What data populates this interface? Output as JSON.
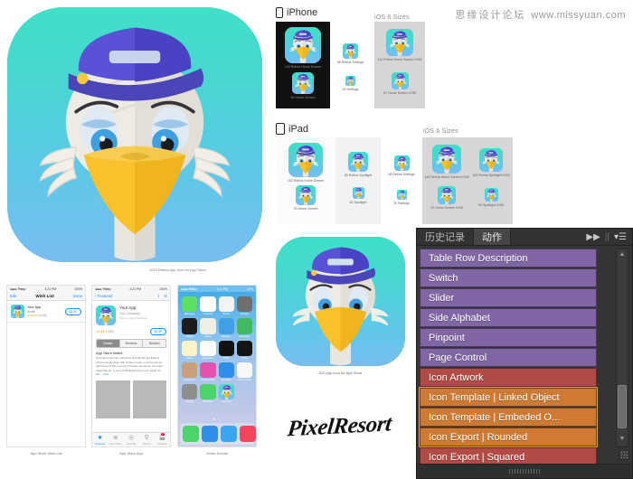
{
  "watermark": {
    "cn": "思缘设计论坛",
    "url": "www.missyuan.com"
  },
  "hero": {
    "name": "app-icon-artwork"
  },
  "iphone_section": {
    "label": "iPhone",
    "ios6_label": "iOS 6 Sizes",
    "dark_items": [
      {
        "cap": "120 Retina Home Screen",
        "size": 56
      },
      {
        "cap": "60 Home Screen",
        "size": 32
      }
    ],
    "light_items": [
      {
        "cap": "58 Retina Settings",
        "size": 24
      },
      {
        "cap": "29 Settings",
        "size": 15
      }
    ],
    "ios6_items": [
      {
        "cap": "114 Retina Home Screen iOS6",
        "size": 36
      },
      {
        "cap": "57 Home Screen iOS6",
        "size": 24
      }
    ]
  },
  "ipad_section": {
    "label": "iPad",
    "ios6_label": "iOS 6 Sizes",
    "col1": [
      {
        "cap": "152 Retina Home Screen",
        "size": 50
      },
      {
        "cap": "76 Home Screen",
        "size": 27
      }
    ],
    "col2": [
      {
        "cap": "80 Retina Spotlight",
        "size": 27
      },
      {
        "cap": "40 Spotlight",
        "size": 16
      }
    ],
    "col3": [
      {
        "cap": "58 Retina Settings",
        "size": 20
      },
      {
        "cap": "29 Settings",
        "size": 13
      }
    ],
    "ios6_col1": [
      {
        "cap": "144 Retina Home Screen iOS6",
        "size": 40
      },
      {
        "cap": "72 Home Screen iOS6",
        "size": 24
      }
    ],
    "ios6_col2": [
      {
        "cap": "100 Retina Spotlight iOS6",
        "size": 30
      },
      {
        "cap": "50 Spotlight iOS6",
        "size": 18
      }
    ]
  },
  "big_icon": {
    "caption": "512 App Icon for App Store"
  },
  "top_caption": "1024 Retina App Icon for App Store",
  "logo": {
    "text": "PixelResort"
  },
  "shot_wishlist": {
    "caption": "App Store Wish List",
    "status": {
      "carrier": "●●●●○ Pixelup ᱸ",
      "time": "4:21 PM",
      "battery": "100%"
    },
    "nav": {
      "left": "Edit",
      "title": "Wish List",
      "right": "Done"
    },
    "row": {
      "name": "Your App",
      "sub": "Health",
      "stars": "★★★★★",
      "count": "(2,232)",
      "price": "$2.99"
    }
  },
  "shot_appstore": {
    "caption": "App Store App",
    "status": {
      "carrier": "●●●●○ Pixelup ᱸ",
      "time": "4:21 PM",
      "battery": "100%"
    },
    "nav": {
      "back": "‹ Featured",
      "share": "share-icon",
      "list": "list-icon"
    },
    "app": {
      "title": "Your App",
      "company": "Your Company ›",
      "iap": "Offers In-App Purchases",
      "stars": "★★★★★",
      "count": "(219)",
      "price": "$2.99"
    },
    "segments": [
      "Details",
      "Reviews",
      "Related"
    ],
    "notes_title": "App Store Notes",
    "notes_body": "Now this is the story all about how My life got flipped, turned upside down that I'd like to take a minute just sit right there I'll tell you how I became the prince of a town called Bel-air. In west Philadelphia born and raised On the",
    "notes_more": "... more",
    "tabs": [
      "Featured",
      "Top Charts",
      "Near Me",
      "Search",
      "Updates"
    ],
    "badge": "2"
  },
  "shot_home": {
    "caption": "Home Screen",
    "status": {
      "carrier": "●●●●○ Pixelup ᱸ",
      "time": "4:21 PM",
      "battery": "47%"
    },
    "apps": [
      {
        "name": "Messages",
        "color": "#5ce063"
      },
      {
        "name": "Calendar",
        "color": "#ffffff"
      },
      {
        "name": "Photos",
        "color": "#f3f3f3"
      },
      {
        "name": "Camera",
        "color": "#6e6e6e"
      },
      {
        "name": "Videos",
        "color": "#1c1c1c"
      },
      {
        "name": "Maps",
        "color": "#eef0e6"
      },
      {
        "name": "Weather",
        "color": "#3fa0e8"
      },
      {
        "name": "Passbook",
        "color": "#3fba5e"
      },
      {
        "name": "Notes",
        "color": "#fdf3c7"
      },
      {
        "name": "Reminders",
        "color": "#fbfbfb"
      },
      {
        "name": "Clock",
        "color": "#111111"
      },
      {
        "name": "Stocks",
        "color": "#141414"
      },
      {
        "name": "Newsstand",
        "color": "#c9a07a"
      },
      {
        "name": "iTunes Store",
        "color": "#e452b0"
      },
      {
        "name": "App Store",
        "color": "#2f8fe8"
      },
      {
        "name": "Game Center",
        "color": "#f7f7f7"
      },
      {
        "name": "Settings",
        "color": "#8e8e8e"
      },
      {
        "name": "FaceTime",
        "color": "#4cd36a"
      },
      {
        "name": "Your App",
        "color": "#49d0dd"
      }
    ],
    "dock": [
      {
        "name": "Phone",
        "color": "#4cd36a"
      },
      {
        "name": "Mail",
        "color": "#2f8fe8"
      },
      {
        "name": "Safari",
        "color": "#3aa6f0"
      },
      {
        "name": "Music",
        "color": "#f5455c"
      }
    ],
    "pagedots": "● ○"
  },
  "photoshop": {
    "tabs": [
      {
        "label": "历史记录",
        "active": false
      },
      {
        "label": "动作",
        "active": true
      }
    ],
    "controls": {
      "collapse": "▶▶",
      "divider": "||",
      "menu": "▾☰"
    },
    "colors": {
      "purple": "#8166a6",
      "red": "#b24a45",
      "orange": "#cf7a32",
      "selection": "#e0a33a"
    },
    "actions": [
      {
        "label": "Table Row Description",
        "color": "purple",
        "selected": false
      },
      {
        "label": "Switch",
        "color": "purple",
        "selected": false
      },
      {
        "label": "Slider",
        "color": "purple",
        "selected": false
      },
      {
        "label": "Side Alphabet",
        "color": "purple",
        "selected": false
      },
      {
        "label": "Pinpoint",
        "color": "purple",
        "selected": false
      },
      {
        "label": "Page Control",
        "color": "purple",
        "selected": false
      },
      {
        "label": "Icon Artwork",
        "color": "red",
        "selected": false
      },
      {
        "label": "Icon Template | Linked Object",
        "color": "orange",
        "selected": true
      },
      {
        "label": "Icon Template | Embeded O...",
        "color": "orange",
        "selected": true
      },
      {
        "label": "Icon Export | Rounded",
        "color": "orange",
        "selected": true
      },
      {
        "label": "Icon Export | Squared",
        "color": "red",
        "selected": false
      }
    ],
    "scroll": {
      "up": "▲",
      "down": "▼"
    }
  }
}
